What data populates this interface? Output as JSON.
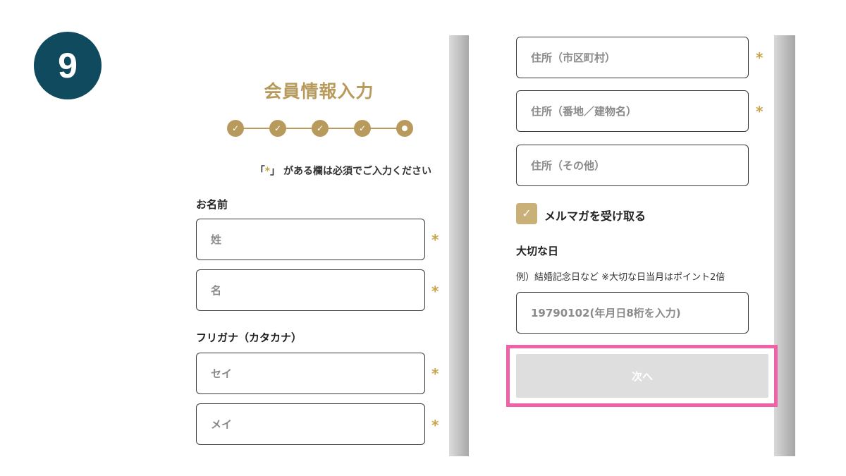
{
  "step_badge": "9",
  "form": {
    "title": "会員情報入力",
    "steps": [
      {
        "icon": "check-icon",
        "state": "done"
      },
      {
        "icon": "check-icon",
        "state": "done"
      },
      {
        "icon": "check-icon",
        "state": "done"
      },
      {
        "icon": "check-icon",
        "state": "done"
      },
      {
        "icon": "current-dot-icon",
        "state": "current"
      }
    ],
    "required_note": {
      "prefix": "「",
      "star": "*",
      "suffix": "」 がある欄は必須でご入力ください"
    },
    "name_section": {
      "label": "お名前",
      "last_name_placeholder": "姓",
      "first_name_placeholder": "名"
    },
    "furigana_section": {
      "label": "フリガナ（カタカナ）",
      "last_kana_placeholder": "セイ",
      "first_kana_placeholder": "メイ"
    },
    "address": {
      "city_placeholder": "住所（市区町村）",
      "street_placeholder": "住所（番地／建物名）",
      "other_placeholder": "住所（その他）"
    },
    "newsletter": {
      "label": "メルマガを受け取る",
      "checked": true
    },
    "important_day": {
      "label": "大切な日",
      "hint": "例）結婚記念日など ※大切な日当月はポイント2倍",
      "placeholder": "19790102(年月日8桁を入力)"
    },
    "next_button": "次へ",
    "required_star": "*"
  },
  "colors": {
    "accent_gold": "#b89a5c",
    "required_star": "#c9a44a",
    "badge": "#0f4a5e",
    "highlight": "#f062a8",
    "button_disabled": "#dedede"
  }
}
